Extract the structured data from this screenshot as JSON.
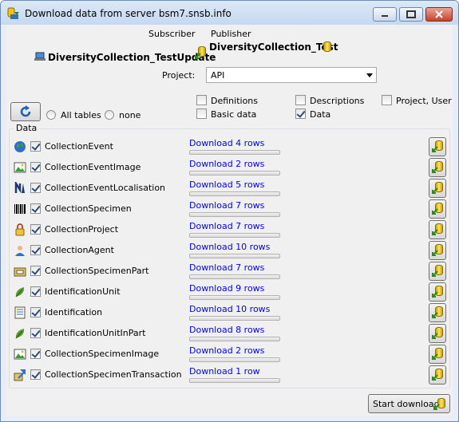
{
  "window": {
    "title": "Download data from server bsm7.snsb.info"
  },
  "header": {
    "subscriber_label": "Subscriber",
    "publisher_label": "Publisher",
    "subscriber_db": "DiversityCollection_TestUpdate",
    "publisher_db": "DiversityCollection_Test"
  },
  "project": {
    "label": "Project:",
    "value": "API"
  },
  "options": {
    "all_tables_label": "All tables",
    "none_label": "none",
    "definitions_label": "Definitions",
    "definitions_checked": false,
    "basic_data_label": "Basic data",
    "basic_data_checked": false,
    "descriptions_label": "Descriptions",
    "descriptions_checked": false,
    "data_label": "Data",
    "data_checked": true,
    "project_user_label": "Project, User",
    "project_user_checked": false
  },
  "data_group": {
    "title": "Data",
    "tables": [
      {
        "name": "CollectionEvent",
        "icon": "globe-icon",
        "checked": true,
        "download_label": "Download 4 rows"
      },
      {
        "name": "CollectionEventImage",
        "icon": "image-icon",
        "checked": true,
        "download_label": "Download 2 rows"
      },
      {
        "name": "CollectionEventLocalisation",
        "icon": "north-arrow-icon",
        "checked": true,
        "download_label": "Download 5 rows"
      },
      {
        "name": "CollectionSpecimen",
        "icon": "barcode-icon",
        "checked": true,
        "download_label": "Download 7 rows"
      },
      {
        "name": "CollectionProject",
        "icon": "lock-icon",
        "checked": true,
        "download_label": "Download 7 rows"
      },
      {
        "name": "CollectionAgent",
        "icon": "person-icon",
        "checked": true,
        "download_label": "Download 10 rows"
      },
      {
        "name": "CollectionSpecimenPart",
        "icon": "part-box-icon",
        "checked": true,
        "download_label": "Download 7 rows"
      },
      {
        "name": "IdentificationUnit",
        "icon": "leaf-icon",
        "checked": true,
        "download_label": "Download 9 rows"
      },
      {
        "name": "Identification",
        "icon": "list-icon",
        "checked": true,
        "download_label": "Download 10 rows"
      },
      {
        "name": "IdentificationUnitInPart",
        "icon": "leaf-icon",
        "checked": true,
        "download_label": "Download 8 rows"
      },
      {
        "name": "CollectionSpecimenImage",
        "icon": "image-icon",
        "checked": true,
        "download_label": "Download 2 rows"
      },
      {
        "name": "CollectionSpecimenTransaction",
        "icon": "transaction-icon",
        "checked": true,
        "download_label": "Download 1 row"
      }
    ]
  },
  "footer": {
    "start_label": "Start download"
  },
  "colors": {
    "link": "#0000ff",
    "titlebar": "#c6d9f0",
    "client": "#f0f0f0"
  }
}
